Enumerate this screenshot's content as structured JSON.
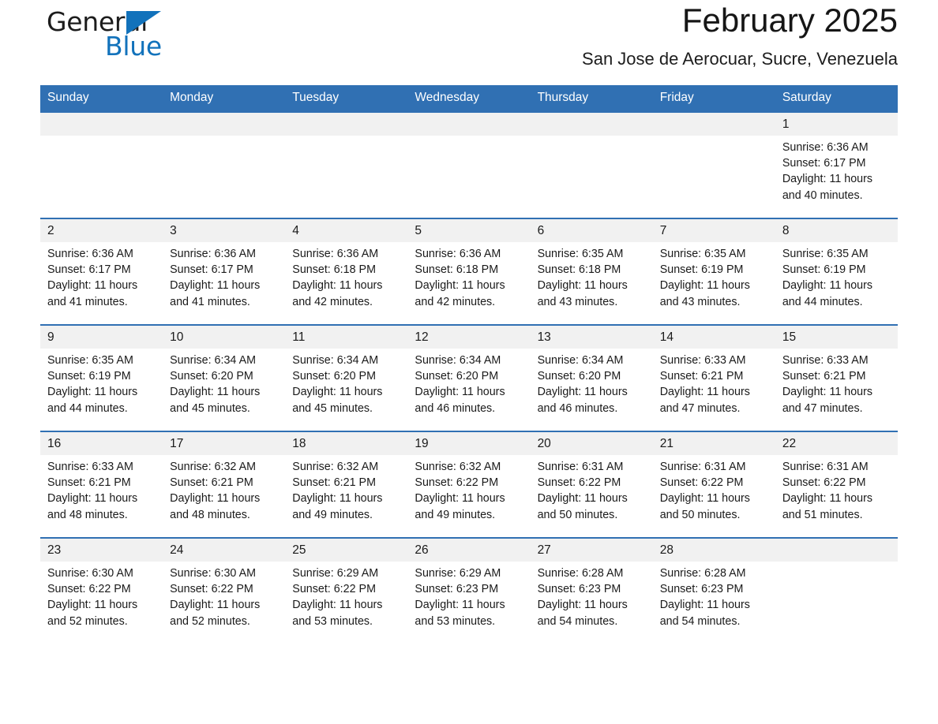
{
  "brand": {
    "name_part1": "General",
    "name_part2": "Blue",
    "accent_color": "#1272bb",
    "header_color": "#3070b3"
  },
  "header": {
    "title": "February 2025",
    "subtitle": "San Jose de Aerocuar, Sucre, Venezuela"
  },
  "weekday_headers": [
    "Sunday",
    "Monday",
    "Tuesday",
    "Wednesday",
    "Thursday",
    "Friday",
    "Saturday"
  ],
  "weeks": [
    [
      {
        "day": "",
        "sunrise": "",
        "sunset": "",
        "daylight": "",
        "empty": true
      },
      {
        "day": "",
        "sunrise": "",
        "sunset": "",
        "daylight": "",
        "empty": true
      },
      {
        "day": "",
        "sunrise": "",
        "sunset": "",
        "daylight": "",
        "empty": true
      },
      {
        "day": "",
        "sunrise": "",
        "sunset": "",
        "daylight": "",
        "empty": true
      },
      {
        "day": "",
        "sunrise": "",
        "sunset": "",
        "daylight": "",
        "empty": true
      },
      {
        "day": "",
        "sunrise": "",
        "sunset": "",
        "daylight": "",
        "empty": true
      },
      {
        "day": "1",
        "sunrise": "Sunrise: 6:36 AM",
        "sunset": "Sunset: 6:17 PM",
        "daylight": "Daylight: 11 hours and 40 minutes.",
        "empty": false
      }
    ],
    [
      {
        "day": "2",
        "sunrise": "Sunrise: 6:36 AM",
        "sunset": "Sunset: 6:17 PM",
        "daylight": "Daylight: 11 hours and 41 minutes.",
        "empty": false
      },
      {
        "day": "3",
        "sunrise": "Sunrise: 6:36 AM",
        "sunset": "Sunset: 6:17 PM",
        "daylight": "Daylight: 11 hours and 41 minutes.",
        "empty": false
      },
      {
        "day": "4",
        "sunrise": "Sunrise: 6:36 AM",
        "sunset": "Sunset: 6:18 PM",
        "daylight": "Daylight: 11 hours and 42 minutes.",
        "empty": false
      },
      {
        "day": "5",
        "sunrise": "Sunrise: 6:36 AM",
        "sunset": "Sunset: 6:18 PM",
        "daylight": "Daylight: 11 hours and 42 minutes.",
        "empty": false
      },
      {
        "day": "6",
        "sunrise": "Sunrise: 6:35 AM",
        "sunset": "Sunset: 6:18 PM",
        "daylight": "Daylight: 11 hours and 43 minutes.",
        "empty": false
      },
      {
        "day": "7",
        "sunrise": "Sunrise: 6:35 AM",
        "sunset": "Sunset: 6:19 PM",
        "daylight": "Daylight: 11 hours and 43 minutes.",
        "empty": false
      },
      {
        "day": "8",
        "sunrise": "Sunrise: 6:35 AM",
        "sunset": "Sunset: 6:19 PM",
        "daylight": "Daylight: 11 hours and 44 minutes.",
        "empty": false
      }
    ],
    [
      {
        "day": "9",
        "sunrise": "Sunrise: 6:35 AM",
        "sunset": "Sunset: 6:19 PM",
        "daylight": "Daylight: 11 hours and 44 minutes.",
        "empty": false
      },
      {
        "day": "10",
        "sunrise": "Sunrise: 6:34 AM",
        "sunset": "Sunset: 6:20 PM",
        "daylight": "Daylight: 11 hours and 45 minutes.",
        "empty": false
      },
      {
        "day": "11",
        "sunrise": "Sunrise: 6:34 AM",
        "sunset": "Sunset: 6:20 PM",
        "daylight": "Daylight: 11 hours and 45 minutes.",
        "empty": false
      },
      {
        "day": "12",
        "sunrise": "Sunrise: 6:34 AM",
        "sunset": "Sunset: 6:20 PM",
        "daylight": "Daylight: 11 hours and 46 minutes.",
        "empty": false
      },
      {
        "day": "13",
        "sunrise": "Sunrise: 6:34 AM",
        "sunset": "Sunset: 6:20 PM",
        "daylight": "Daylight: 11 hours and 46 minutes.",
        "empty": false
      },
      {
        "day": "14",
        "sunrise": "Sunrise: 6:33 AM",
        "sunset": "Sunset: 6:21 PM",
        "daylight": "Daylight: 11 hours and 47 minutes.",
        "empty": false
      },
      {
        "day": "15",
        "sunrise": "Sunrise: 6:33 AM",
        "sunset": "Sunset: 6:21 PM",
        "daylight": "Daylight: 11 hours and 47 minutes.",
        "empty": false
      }
    ],
    [
      {
        "day": "16",
        "sunrise": "Sunrise: 6:33 AM",
        "sunset": "Sunset: 6:21 PM",
        "daylight": "Daylight: 11 hours and 48 minutes.",
        "empty": false
      },
      {
        "day": "17",
        "sunrise": "Sunrise: 6:32 AM",
        "sunset": "Sunset: 6:21 PM",
        "daylight": "Daylight: 11 hours and 48 minutes.",
        "empty": false
      },
      {
        "day": "18",
        "sunrise": "Sunrise: 6:32 AM",
        "sunset": "Sunset: 6:21 PM",
        "daylight": "Daylight: 11 hours and 49 minutes.",
        "empty": false
      },
      {
        "day": "19",
        "sunrise": "Sunrise: 6:32 AM",
        "sunset": "Sunset: 6:22 PM",
        "daylight": "Daylight: 11 hours and 49 minutes.",
        "empty": false
      },
      {
        "day": "20",
        "sunrise": "Sunrise: 6:31 AM",
        "sunset": "Sunset: 6:22 PM",
        "daylight": "Daylight: 11 hours and 50 minutes.",
        "empty": false
      },
      {
        "day": "21",
        "sunrise": "Sunrise: 6:31 AM",
        "sunset": "Sunset: 6:22 PM",
        "daylight": "Daylight: 11 hours and 50 minutes.",
        "empty": false
      },
      {
        "day": "22",
        "sunrise": "Sunrise: 6:31 AM",
        "sunset": "Sunset: 6:22 PM",
        "daylight": "Daylight: 11 hours and 51 minutes.",
        "empty": false
      }
    ],
    [
      {
        "day": "23",
        "sunrise": "Sunrise: 6:30 AM",
        "sunset": "Sunset: 6:22 PM",
        "daylight": "Daylight: 11 hours and 52 minutes.",
        "empty": false
      },
      {
        "day": "24",
        "sunrise": "Sunrise: 6:30 AM",
        "sunset": "Sunset: 6:22 PM",
        "daylight": "Daylight: 11 hours and 52 minutes.",
        "empty": false
      },
      {
        "day": "25",
        "sunrise": "Sunrise: 6:29 AM",
        "sunset": "Sunset: 6:22 PM",
        "daylight": "Daylight: 11 hours and 53 minutes.",
        "empty": false
      },
      {
        "day": "26",
        "sunrise": "Sunrise: 6:29 AM",
        "sunset": "Sunset: 6:23 PM",
        "daylight": "Daylight: 11 hours and 53 minutes.",
        "empty": false
      },
      {
        "day": "27",
        "sunrise": "Sunrise: 6:28 AM",
        "sunset": "Sunset: 6:23 PM",
        "daylight": "Daylight: 11 hours and 54 minutes.",
        "empty": false
      },
      {
        "day": "28",
        "sunrise": "Sunrise: 6:28 AM",
        "sunset": "Sunset: 6:23 PM",
        "daylight": "Daylight: 11 hours and 54 minutes.",
        "empty": false
      },
      {
        "day": "",
        "sunrise": "",
        "sunset": "",
        "daylight": "",
        "empty": true
      }
    ]
  ]
}
